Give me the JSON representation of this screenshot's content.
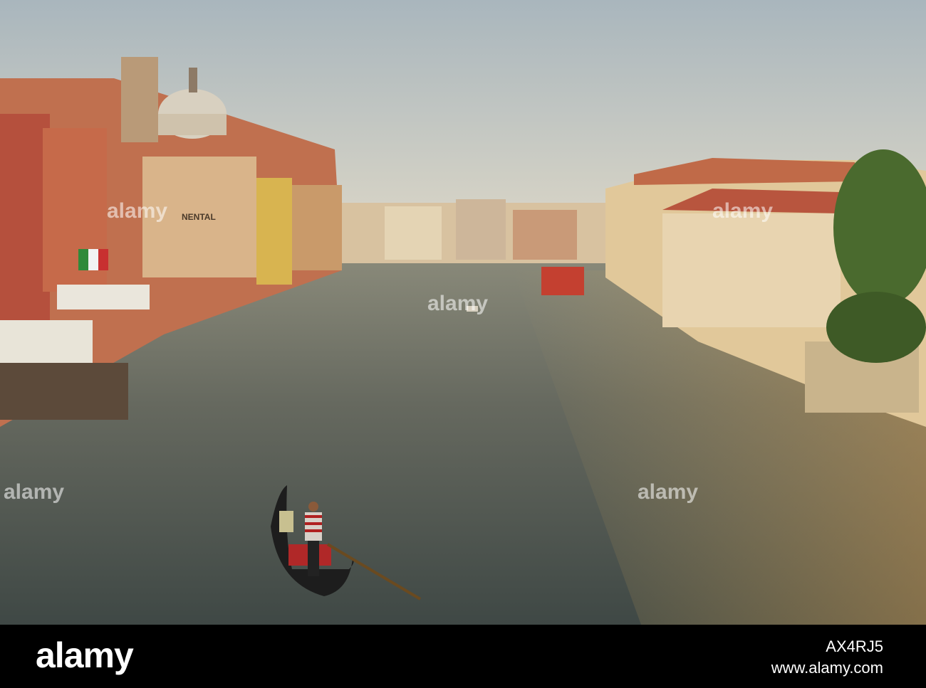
{
  "photo": {
    "sign_text": "NENTAL",
    "watermark_text": "alamy"
  },
  "footer": {
    "logo": "alamy",
    "image_id": "AX4RJ5",
    "url": "www.alamy.com"
  },
  "colors": {
    "sky": "#b9c3c6",
    "water": "#5a6360",
    "building_warm": "#d9a066",
    "building_red": "#b8553e"
  }
}
